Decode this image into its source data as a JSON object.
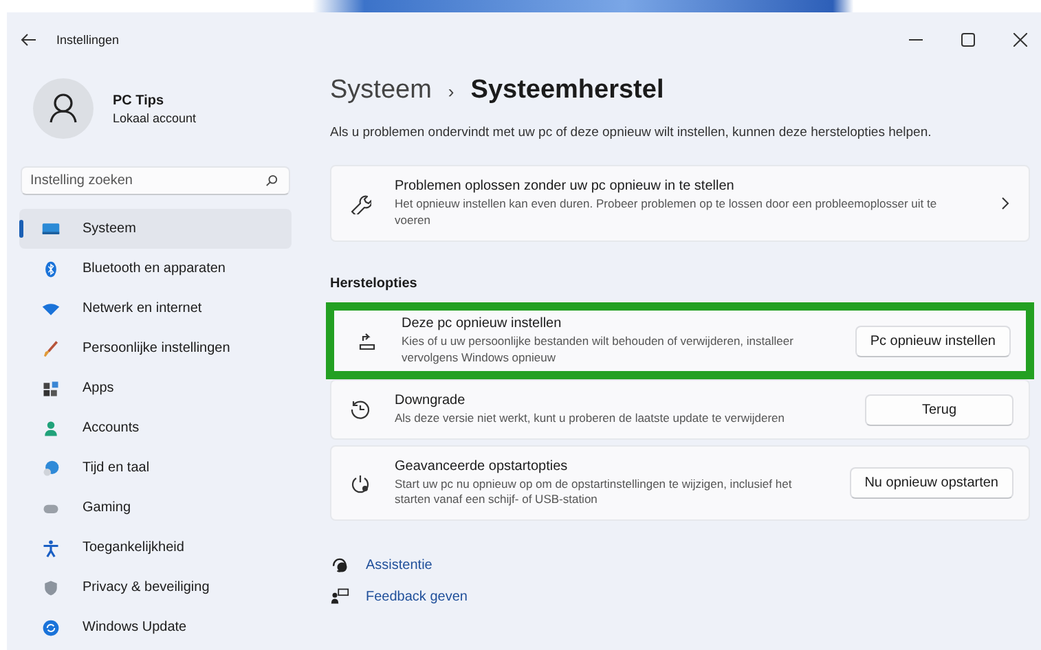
{
  "window": {
    "title": "Instellingen"
  },
  "profile": {
    "name": "PC Tips",
    "account": "Lokaal account"
  },
  "search": {
    "placeholder": "Instelling zoeken"
  },
  "sidebar": {
    "items": [
      {
        "label": "Systeem",
        "selected": true
      },
      {
        "label": "Bluetooth en apparaten",
        "selected": false
      },
      {
        "label": "Netwerk en internet",
        "selected": false
      },
      {
        "label": "Persoonlijke instellingen",
        "selected": false
      },
      {
        "label": "Apps",
        "selected": false
      },
      {
        "label": "Accounts",
        "selected": false
      },
      {
        "label": "Tijd en taal",
        "selected": false
      },
      {
        "label": "Gaming",
        "selected": false
      },
      {
        "label": "Toegankelijkheid",
        "selected": false
      },
      {
        "label": "Privacy & beveiliging",
        "selected": false
      },
      {
        "label": "Windows Update",
        "selected": false
      }
    ]
  },
  "breadcrumb": {
    "parent": "Systeem",
    "separator": "›",
    "current": "Systeemherstel"
  },
  "description": "Als u problemen ondervindt met uw pc of deze opnieuw wilt instellen, kunnen deze herstelopties helpen.",
  "top_card": {
    "title": "Problemen oplossen zonder uw pc opnieuw in te stellen",
    "subtitle": "Het opnieuw instellen kan even duren. Probeer problemen op te lossen door een probleemoplosser uit te voeren"
  },
  "section_title": "Herstelopties",
  "options": [
    {
      "title": "Deze pc opnieuw instellen",
      "subtitle": "Kies of u uw persoonlijke bestanden wilt behouden of verwijderen, installeer vervolgens Windows opnieuw",
      "button": "Pc opnieuw instellen",
      "highlighted": true
    },
    {
      "title": "Downgrade",
      "subtitle": "Als deze versie niet werkt, kunt u proberen de laatste update te verwijderen",
      "button": "Terug",
      "highlighted": false
    },
    {
      "title": "Geavanceerde opstartopties",
      "subtitle": "Start uw pc nu opnieuw op om de opstartinstellingen te wijzigen, inclusief het starten vanaf een schijf- of USB-station",
      "button": "Nu opnieuw opstarten",
      "highlighted": false
    }
  ],
  "links": [
    {
      "label": "Assistentie"
    },
    {
      "label": "Feedback geven"
    }
  ]
}
